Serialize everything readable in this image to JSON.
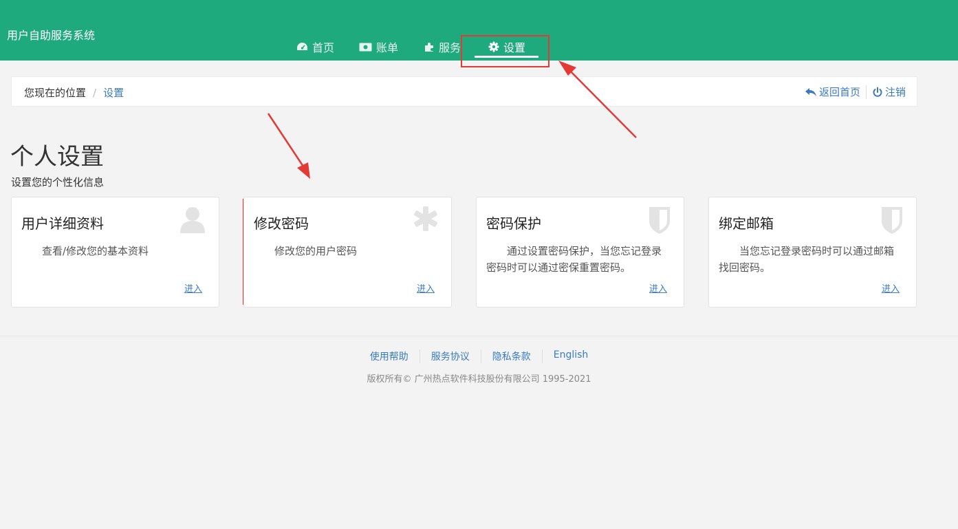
{
  "header": {
    "app_title": "用户自助服务系统",
    "nav": [
      {
        "label": "首页",
        "icon": "dashboard-icon"
      },
      {
        "label": "账单",
        "icon": "money-icon"
      },
      {
        "label": "服务",
        "icon": "puzzle-icon"
      },
      {
        "label": "设置",
        "icon": "gear-icon",
        "active": true
      }
    ]
  },
  "breadcrumb": {
    "prefix": "您现在的位置",
    "separator": "/",
    "current": "设置",
    "back_home": "返回首页",
    "logout": "注销"
  },
  "page": {
    "title": "个人设置",
    "subtitle": "设置您的个性化信息"
  },
  "cards": [
    {
      "title": "用户详细资料",
      "desc": "查看/修改您的基本资料",
      "link": "进入",
      "icon": "user-icon"
    },
    {
      "title": "修改密码",
      "desc": "修改您的用户密码",
      "link": "进入",
      "icon": "asterisk-icon"
    },
    {
      "title": "密码保护",
      "desc": "通过设置密码保护，当您忘记登录密码时可以通过密保重置密码。",
      "link": "进入",
      "icon": "shield-icon"
    },
    {
      "title": "绑定邮箱",
      "desc": "当您忘记登录密码时可以通过邮箱找回密码。",
      "link": "进入",
      "icon": "shield-icon"
    }
  ],
  "footer": {
    "links": [
      "使用帮助",
      "服务协议",
      "隐私条款",
      "English"
    ],
    "copyright": "版权所有© 广州热点软件科技股份有限公司 1995-2021"
  },
  "colors": {
    "header_bg": "#1faa7e",
    "link": "#3a7bbf",
    "annotation": "#e53935"
  }
}
